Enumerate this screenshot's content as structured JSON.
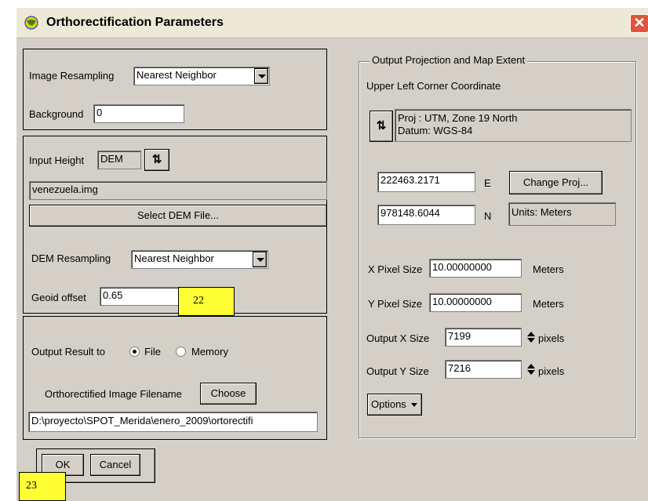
{
  "window": {
    "title": "Orthorectification Parameters",
    "close_glyph": "✕"
  },
  "resampling": {
    "image_resampling_label": "Image Resampling",
    "image_resampling_value": "Nearest Neighbor",
    "background_label": "Background",
    "background_value": "0"
  },
  "dem": {
    "input_height_label": "Input Height",
    "input_height_value": "DEM",
    "dem_file": "venezuela.img",
    "select_dem_label": "Select DEM File...",
    "dem_resampling_label": "DEM Resampling",
    "dem_resampling_value": "Nearest Neighbor",
    "geoid_offset_label": "Geoid offset",
    "geoid_offset_value": "0.65"
  },
  "output": {
    "output_result_label": "Output Result to",
    "file_label": "File",
    "memory_label": "Memory",
    "filename_label": "Orthorectified Image Filename",
    "choose_label": "Choose",
    "filename_value": "D:\\proyecto\\SPOT_Merida\\enero_2009\\ortorectifi"
  },
  "projection": {
    "group_label": "Output Projection and Map Extent",
    "ulc_label": "Upper Left Corner Coordinate",
    "proj_line1": "Proj : UTM, Zone 19 North",
    "proj_line2": "Datum: WGS-84",
    "easting": "222463.2171",
    "easting_unit": "E",
    "change_proj_label": "Change Proj...",
    "northing": "978148.6044",
    "northing_unit": "N",
    "units_label": "Units: Meters",
    "x_pixel_label": "X Pixel Size",
    "x_pixel_value": "10.00000000",
    "x_pixel_unit": "Meters",
    "y_pixel_label": "Y Pixel Size",
    "y_pixel_value": "10.00000000",
    "y_pixel_unit": "Meters",
    "out_x_label": "Output X Size",
    "out_x_value": "7199",
    "out_x_unit": "pixels",
    "out_y_label": "Output Y Size",
    "out_y_value": "7216",
    "out_y_unit": "pixels",
    "options_label": "Options"
  },
  "buttons": {
    "ok_label": "OK",
    "cancel_label": "Cancel"
  },
  "annotations": {
    "note_22": "22",
    "note_23": "23"
  },
  "colors": {
    "note_bg": "#ffff33",
    "dialog_bg": "#d4d0c8",
    "close_red": "#e0563c"
  },
  "icons": {
    "title": "globe-icon",
    "swap": "swap-arrows-icon",
    "spin": "spin-updown-icon"
  }
}
